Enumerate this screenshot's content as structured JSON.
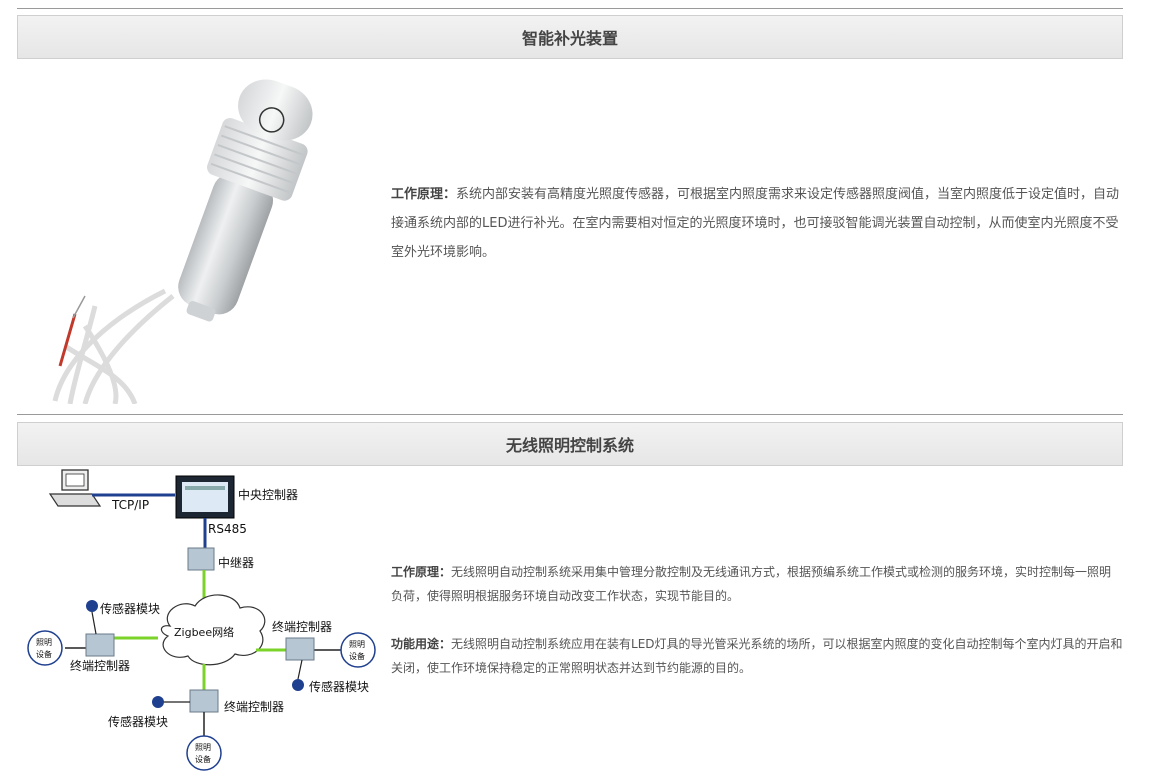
{
  "section1": {
    "title": "智能补光装置",
    "label": "工作原理",
    "colon": "：",
    "text": "系统内部安装有高精度光照度传感器，可根据室内照度需求来设定传感器照度阀值，当室内照度低于设定值时，自动接通系统内部的LED进行补光。在室内需要相对恒定的光照度环境时，也可接驳智能调光装置自动控制，从而使室内光照度不受室外光环境影响。"
  },
  "section2": {
    "title": "无线照明控制系统",
    "principle_label": "工作原理",
    "principle_text": "无线照明自动控制系统采用集中管理分散控制及无线通讯方式，根据预编系统工作模式或检测的服务环境，实时控制每一照明负荷，使得照明根据服务环境自动改变工作状态，实现节能目的。",
    "usage_label": "功能用途",
    "usage_text": "无线照明自动控制系统应用在装有LED灯具的导光管采光系统的场所，可以根据室内照度的变化自动控制每个室内灯具的开启和关闭，使工作环境保持稳定的正常照明状态并达到节约能源的目的。",
    "colon": "："
  },
  "diagram": {
    "tcpip": "TCP/IP",
    "central": "中央控制器",
    "rs485": "RS485",
    "relay": "中继器",
    "sensor": "传感器模块",
    "terminal": "终端控制器",
    "zigbee": "Zigbee网络",
    "device_line1": "照明",
    "device_line2": "设备"
  }
}
